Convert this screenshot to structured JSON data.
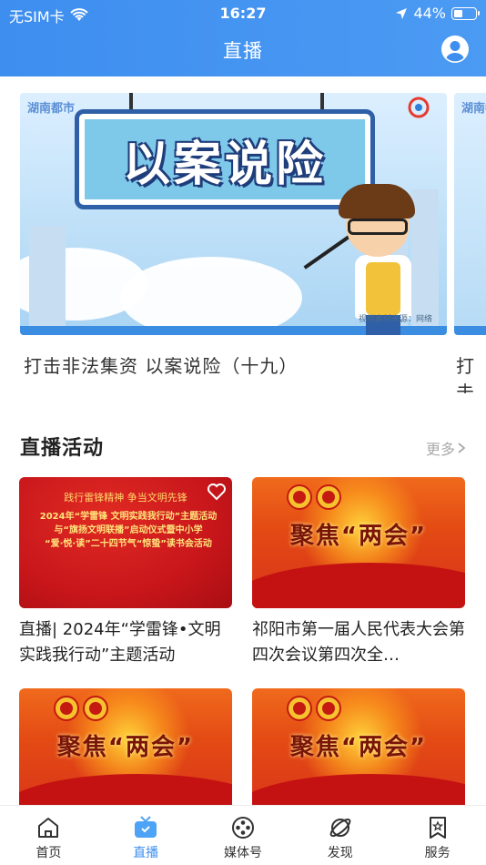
{
  "status_bar": {
    "carrier": "无SIM卡",
    "time": "16:27",
    "battery": "44%",
    "battery_level": 0.44
  },
  "header": {
    "title": "直播"
  },
  "carousel": {
    "active": {
      "logo_text": "湖南都市",
      "sign_text": "以案说险",
      "credit_text": "视频素材来源：网络",
      "title": "打击非法集资 以案说险（十九）"
    },
    "next": {
      "logo_text": "湖南都市",
      "title": "打击"
    }
  },
  "live_activities": {
    "title": "直播活动",
    "more_label": "更多",
    "cards": [
      {
        "title": "直播| 2024年“学雷锋•文明实践我行动”主题活动",
        "thumb": {
          "kind": "red",
          "slogan": "践行雷锋精神  争当文明先锋",
          "lines": [
            "2024年“学雷锋 文明实践我行动”主题活动",
            "与“旗扬文明联播”启动仪式暨中小学",
            "“爱·悦·读”二十四节气“惊蛰”读书会活动"
          ]
        }
      },
      {
        "title": "祁阳市第一届人民代表大会第四次会议第四次全…",
        "thumb": {
          "kind": "orange",
          "text": "聚焦“两会”"
        }
      },
      {
        "title": "",
        "thumb": {
          "kind": "orange",
          "text": "聚焦“两会”"
        }
      },
      {
        "title": "",
        "thumb": {
          "kind": "orange",
          "text": "聚焦“两会”"
        }
      }
    ]
  },
  "tabbar": {
    "items": [
      {
        "label": "首页",
        "icon": "home-icon",
        "active": false
      },
      {
        "label": "直播",
        "icon": "tv-icon",
        "active": true
      },
      {
        "label": "媒体号",
        "icon": "film-reel-icon",
        "active": false
      },
      {
        "label": "发现",
        "icon": "planet-icon",
        "active": false
      },
      {
        "label": "服务",
        "icon": "bookmark-star-icon",
        "active": false
      }
    ]
  },
  "colors": {
    "header_blue": "#3e8ef0",
    "active_tab": "#3b8ef0",
    "more_gray": "#aaaaaa"
  }
}
